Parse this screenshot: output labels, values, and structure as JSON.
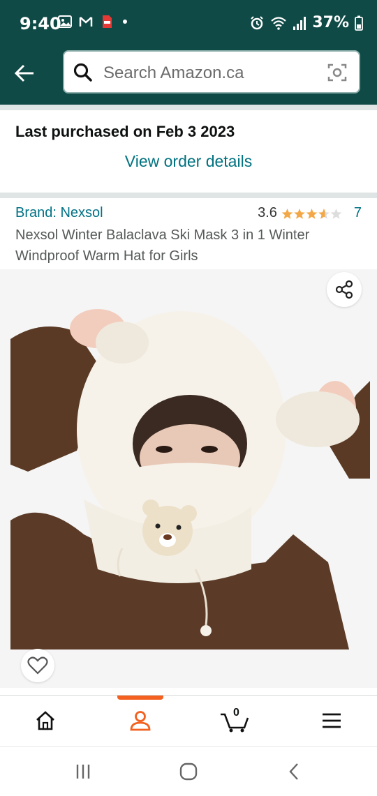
{
  "status_bar": {
    "time": "9:40",
    "battery": "37%",
    "icons_left": [
      "gallery-icon",
      "gmail-icon",
      "pdf-icon",
      "dot"
    ],
    "icons_right": [
      "alarm-icon",
      "wifi-icon",
      "signal-icon",
      "battery-icon"
    ]
  },
  "search": {
    "placeholder": "Search Amazon.ca"
  },
  "purchase": {
    "label": "Last purchased on Feb 3 2023",
    "link": "View order details"
  },
  "product": {
    "brand": "Brand: Nexsol",
    "rating": "3.6",
    "rating_value": 3.6,
    "rating_max": 5,
    "review_count": "7",
    "title": "Nexsol Winter Balaclava Ski Mask 3 in 1 Winter Windproof Warm Hat for Girls"
  },
  "bottom_nav": {
    "items": [
      "home-icon",
      "account-icon",
      "cart-icon",
      "menu-icon"
    ],
    "active": "account-icon",
    "cart_count": "0"
  },
  "colors": {
    "header": "#0f4a46",
    "link": "#007185",
    "star": "#f3a847",
    "active_tab": "#f3601f"
  }
}
